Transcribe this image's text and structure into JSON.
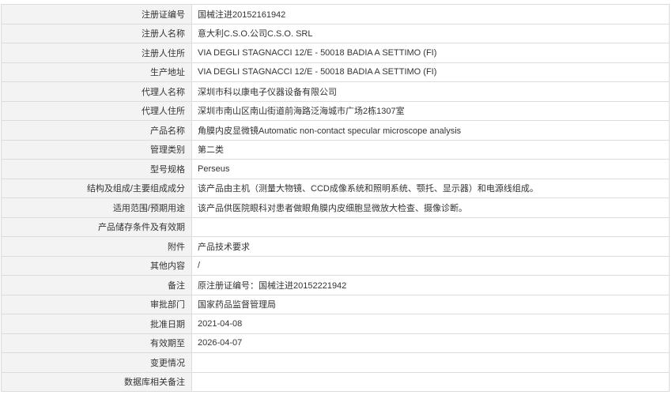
{
  "record": {
    "rows": [
      {
        "label": "注册证编号",
        "value": "国械注进20152161942"
      },
      {
        "label": "注册人名称",
        "value": "意大利C.S.O.公司C.S.O. SRL"
      },
      {
        "label": "注册人住所",
        "value": "VIA DEGLI STAGNACCI 12/E - 50018 BADIA A SETTIMO (FI)"
      },
      {
        "label": "生产地址",
        "value": "VIA DEGLI STAGNACCI 12/E - 50018 BADIA A SETTIMO (FI)"
      },
      {
        "label": "代理人名称",
        "value": "深圳市科以康电子仪器设备有限公司"
      },
      {
        "label": "代理人住所",
        "value": "深圳市南山区南山街道前海路泛海城市广场2栋1307室"
      },
      {
        "label": "产品名称",
        "value": "角膜内皮显微镜Automatic non-contact specular microscope analysis"
      },
      {
        "label": "管理类别",
        "value": "第二类"
      },
      {
        "label": "型号规格",
        "value": "Perseus"
      },
      {
        "label": "结构及组成/主要组成成分",
        "value": "该产品由主机（测量大物镜、CCD成像系统和照明系统、颚托、显示器）和电源线组成。"
      },
      {
        "label": "适用范围/预期用途",
        "value": "该产品供医院眼科对患者做眼角膜内皮细胞显微放大检查、摄像诊断。"
      },
      {
        "label": "产品储存条件及有效期",
        "value": ""
      },
      {
        "label": "附件",
        "value": "产品技术要求"
      },
      {
        "label": "其他内容",
        "value": "/"
      },
      {
        "label": "备注",
        "value": "原注册证编号：国械注进20152221942"
      },
      {
        "label": "审批部门",
        "value": "国家药品监督管理局"
      },
      {
        "label": "批准日期",
        "value": "2021-04-08"
      },
      {
        "label": "有效期至",
        "value": "2026-04-07"
      },
      {
        "label": "变更情况",
        "value": ""
      },
      {
        "label": "数据库相关备注",
        "value": ""
      }
    ]
  }
}
